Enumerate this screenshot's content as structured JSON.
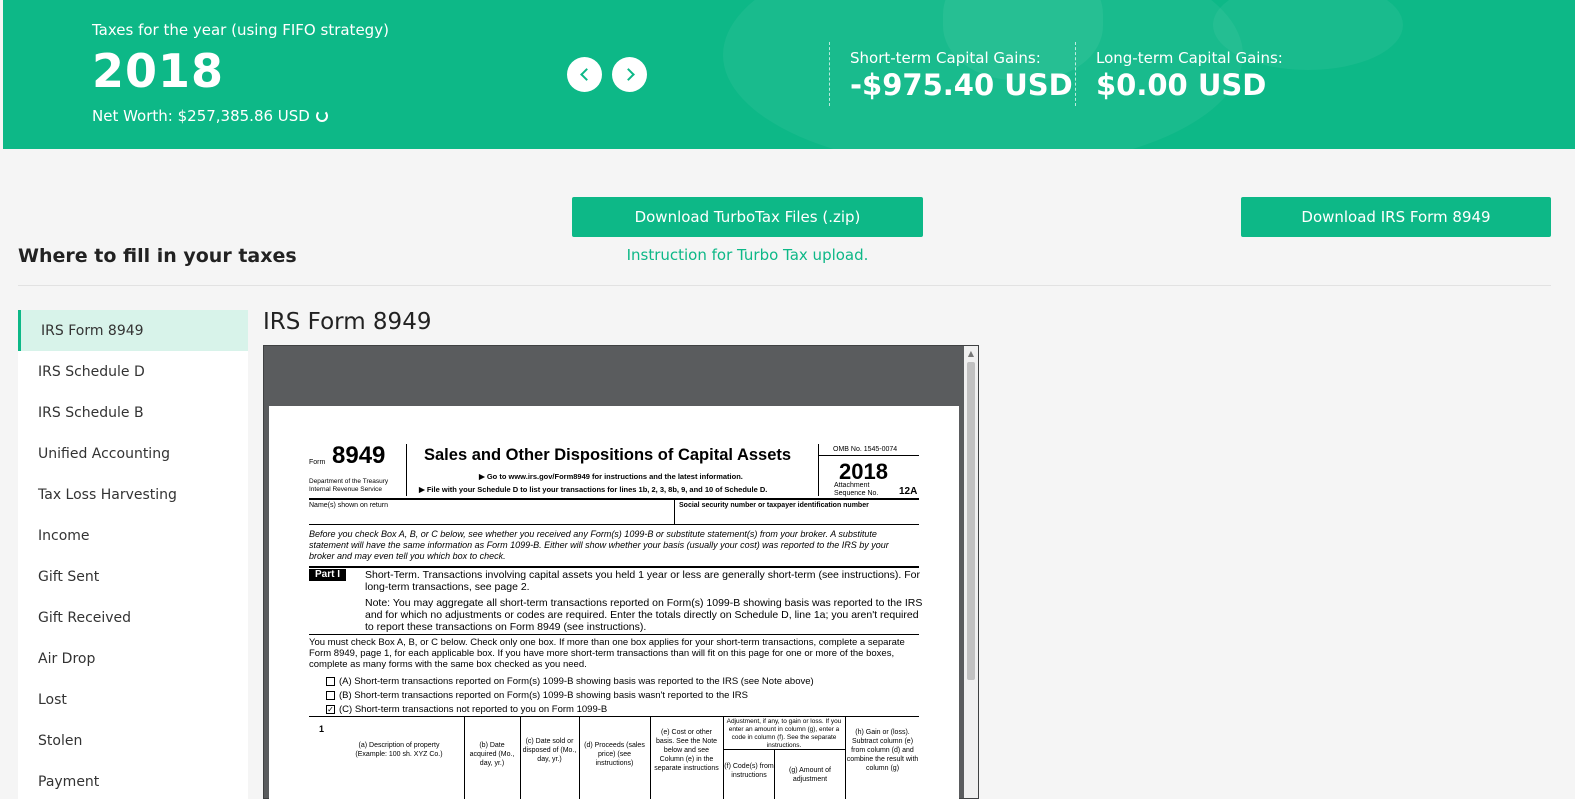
{
  "header": {
    "subtitle": "Taxes for the year (using FIFO strategy)",
    "year": "2018",
    "net_worth": "Net Worth: $257,385.86 USD",
    "short_term_label": "Short-term Capital Gains:",
    "short_term_value": "-$975.40 USD",
    "long_term_label": "Long-term Capital Gains:",
    "long_term_value": "$0.00 USD"
  },
  "actions": {
    "turbotax_button": "Download TurboTax Files (.zip)",
    "irs_button": "Download IRS Form 8949",
    "instruction_link": "Instruction for Turbo Tax upload."
  },
  "section_title": "Where to fill in your taxes",
  "sidebar": {
    "items": [
      {
        "label": "IRS Form 8949",
        "active": true
      },
      {
        "label": "IRS Schedule D"
      },
      {
        "label": "IRS Schedule B"
      },
      {
        "label": "Unified Accounting"
      },
      {
        "label": "Tax Loss Harvesting"
      },
      {
        "label": "Income"
      },
      {
        "label": "Gift Sent"
      },
      {
        "label": "Gift Received"
      },
      {
        "label": "Air Drop"
      },
      {
        "label": "Lost"
      },
      {
        "label": "Stolen"
      },
      {
        "label": "Payment"
      }
    ]
  },
  "content": {
    "title": "IRS Form 8949"
  },
  "form": {
    "form_label": "Form",
    "form_number": "8949",
    "department": "Department of the Treasury Internal Revenue Service",
    "title": "Sales and Other Dispositions of Capital Assets",
    "goto": "▶ Go to www.irs.gov/Form8949 for instructions and the latest information.",
    "file_with": "▶ File with your Schedule D to list your transactions for lines 1b, 2, 3, 8b, 9, and 10 of Schedule D.",
    "omb": "OMB No. 1545-0074",
    "year": "2018",
    "attachment": "Attachment Sequence No.",
    "sequence": "12A",
    "name_label": "Name(s) shown on return",
    "ssn_label": "Social security number or taxpayer identification number",
    "before_text": "Before you check Box A, B, or C below, see whether you received any Form(s) 1099-B or substitute statement(s) from your broker. A substitute statement will have the same information as Form 1099-B. Either will show whether your basis (usually your cost) was reported to the IRS by your broker and may even tell you which box to check.",
    "part": "Part I",
    "short_term_text": "Short-Term. Transactions involving capital assets you held 1 year or less are generally short-term (see instructions). For long-term transactions, see page 2.",
    "note_text": "Note: You may aggregate all short-term transactions reported on Form(s) 1099-B showing basis was reported to the IRS and for which no adjustments or codes are required. Enter the totals directly on Schedule D, line 1a; you aren't required to report these transactions on Form 8949 (see instructions).",
    "must_text": "You must check Box A, B, or C below. Check only one box. If more than one box applies for your short-term transactions, complete a separate Form 8949, page 1, for each applicable box. If you have more short-term transactions than will fit on this page for one or more of the boxes, complete as many forms with the same box checked as you need.",
    "checkbox_a": "(A) Short-term transactions reported on Form(s) 1099-B showing basis was reported to the IRS (see Note above)",
    "checkbox_b": "(B) Short-term transactions reported on Form(s) 1099-B showing basis wasn't reported to the IRS",
    "checkbox_c": "(C) Short-term transactions not reported to you on Form 1099-B",
    "checked_box": "C",
    "line_number": "1",
    "col_a": "(a) Description of property (Example: 100 sh. XYZ Co.)",
    "col_b": "(b) Date acquired (Mo., day, yr.)",
    "col_c": "(c) Date sold or disposed of (Mo., day, yr.)",
    "col_d": "(d) Proceeds (sales price) (see instructions)",
    "col_e": "(e) Cost or other basis. See the Note below and see Column (e) in the separate instructions",
    "col_adj": "Adjustment, if any, to gain or loss. If you enter an amount in column (g), enter a code in column (f). See the separate instructions.",
    "col_f": "(f) Code(s) from instructions",
    "col_g": "(g) Amount of adjustment",
    "col_h": "(h) Gain or (loss). Subtract column (e) from column (d) and combine the result with column (g)"
  },
  "colors": {
    "accent": "#0db887",
    "active_bg": "#d8f3ea"
  }
}
